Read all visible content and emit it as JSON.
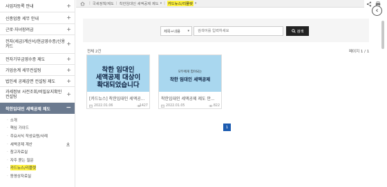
{
  "sidebar": {
    "menu": [
      {
        "label": "사업자등록 안내"
      },
      {
        "label": "신종업종 세무 안내"
      },
      {
        "label": "근로·자녀장려금"
      },
      {
        "label": "전자(세금)계산서/현금영수증/신용카드"
      },
      {
        "label": "전자기부금영수증 제도"
      },
      {
        "label": "가업승계 세무컨설팅"
      },
      {
        "label": "법인세 공제감면 컨설팅 제도"
      },
      {
        "label": "과세정보 사전조회/비밀유지확인 컨설팅"
      },
      {
        "label": "착한임대인 세액공제 제도"
      }
    ],
    "sub_items": [
      {
        "label": "소개"
      },
      {
        "label": "핵심 가이드"
      },
      {
        "label": "주요서식 작성요령/사례"
      },
      {
        "label": "세액공제 계산"
      },
      {
        "label": "참고자료실"
      },
      {
        "label": "자주 묻는 질문"
      },
      {
        "label": "카드뉴스/리플렛"
      },
      {
        "label": "동영상자료실"
      }
    ]
  },
  "breadcrumb": {
    "items": [
      "국세정책/제도",
      "착한임대인 세액공제 제도"
    ],
    "current": "카드뉴스/리플렛"
  },
  "search": {
    "select_value": "제목+내용",
    "placeholder": "검색어를 입력하세요",
    "button_label": "검색"
  },
  "list": {
    "total": "전체 2건",
    "page": "페이지 1 / 1",
    "cards": [
      {
        "thumb_lines": [
          "착한 임대인",
          "세액공제 대상이",
          "확대되었습니다"
        ],
        "title": "[카드뉴스] 착한임대인 세액공...",
        "date": "2022.01.06",
        "views": "1427"
      },
      {
        "thumb_small": "모두에게 힘이되는",
        "thumb_big": "착한 임대인 세액공제",
        "title": "착한임대인 세액공제 제도 안...",
        "date": "2022.01.05",
        "views": "822"
      }
    ]
  },
  "pagination": {
    "current": "1"
  },
  "colors": {
    "active_menu": "#6b7a8f",
    "highlight": "#fff23d",
    "thumb_bg": "#a9d7ef",
    "page_btn": "#1c5bb0"
  }
}
